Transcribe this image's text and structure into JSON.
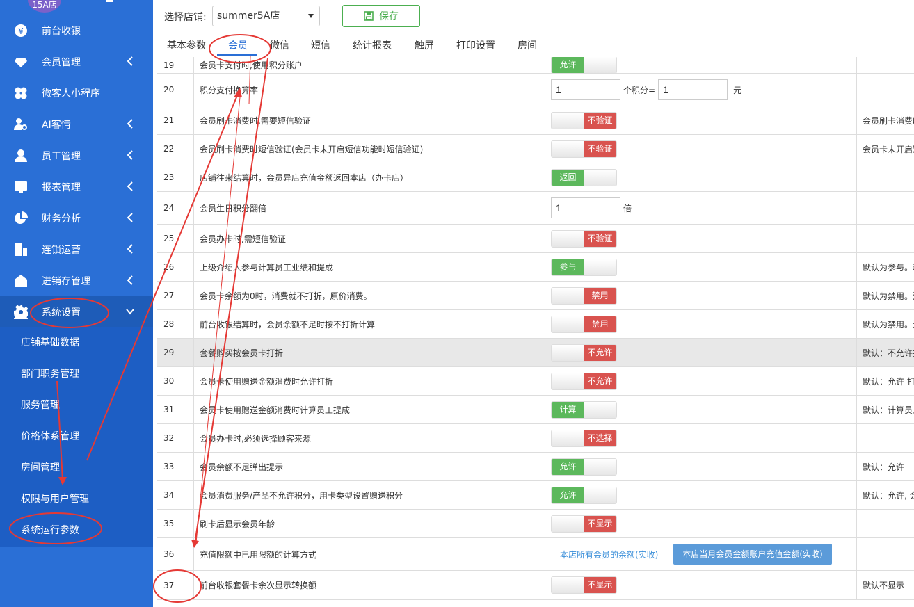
{
  "sidebar": {
    "avatar_text": "15A店",
    "items": [
      {
        "label": "前台收银",
        "icon": "yen-coin-icon",
        "has_chevron": false
      },
      {
        "label": "会员管理",
        "icon": "diamond-icon",
        "has_chevron": true
      },
      {
        "label": "微客人小程序",
        "icon": "clover-icon",
        "has_chevron": false
      },
      {
        "label": "AI客情",
        "icon": "user-search-icon",
        "has_chevron": true
      },
      {
        "label": "员工管理",
        "icon": "user-icon",
        "has_chevron": true
      },
      {
        "label": "报表管理",
        "icon": "monitor-icon",
        "has_chevron": true
      },
      {
        "label": "财务分析",
        "icon": "pie-chart-icon",
        "has_chevron": true
      },
      {
        "label": "连锁运营",
        "icon": "building-icon",
        "has_chevron": true
      },
      {
        "label": "进销存管理",
        "icon": "warehouse-icon",
        "has_chevron": true
      },
      {
        "label": "系统设置",
        "icon": "gear-icon",
        "has_chevron": true,
        "expanded": true
      }
    ],
    "sub_items": [
      "店铺基础数据",
      "部门职务管理",
      "服务管理",
      "价格体系管理",
      "房间管理",
      "权限与用户管理",
      "系统运行参数"
    ]
  },
  "topbar": {
    "shop_label": "选择店铺:",
    "shop_value": "summer5A店",
    "save_label": "保存",
    "tabs": [
      "基本参数",
      "会员",
      "微信",
      "短信",
      "统计报表",
      "触屏",
      "打印设置",
      "房间"
    ],
    "active_tab": "会员"
  },
  "rows": [
    {
      "num": "19",
      "name": "会员卡支付时,使用积分账户",
      "toggle": {
        "label": "允许",
        "state": "on"
      },
      "note": ""
    },
    {
      "num": "20",
      "name": "积分支付换算率",
      "inputs": {
        "a": "1",
        "a_unit": "个积分=",
        "b": "1",
        "b_unit": "元"
      },
      "note": ""
    },
    {
      "num": "21",
      "name": "会员刷卡消费时,需要短信验证",
      "toggle": {
        "label": "不验证",
        "state": "off"
      },
      "note": "会员刷卡消费时"
    },
    {
      "num": "22",
      "name": "会员刷卡消费时短信验证(会员卡未开启短信功能时短信验证)",
      "toggle": {
        "label": "不验证",
        "state": "off"
      },
      "note": "会员卡未开启短"
    },
    {
      "num": "23",
      "name": "店铺往来结算时，会员异店充值金额返回本店（办卡店）",
      "toggle": {
        "label": "返回",
        "state": "on"
      },
      "note": ""
    },
    {
      "num": "24",
      "name": "会员生日积分翻倍",
      "inputs": {
        "a": "1",
        "a_unit": "倍"
      },
      "note": ""
    },
    {
      "num": "25",
      "name": "会员办卡时,需短信验证",
      "toggle": {
        "label": "不验证",
        "state": "off"
      },
      "note": ""
    },
    {
      "num": "26",
      "name": "上级介绍人参与计算员工业绩和提成",
      "toggle": {
        "label": "参与",
        "state": "on"
      },
      "note": "默认为参与。着"
    },
    {
      "num": "27",
      "name": "会员卡余额为0时，消费就不打折，原价消费。",
      "toggle": {
        "label": "禁用",
        "state": "off"
      },
      "note": "默认为禁用。注"
    },
    {
      "num": "28",
      "name": "前台收银结算时，会员余额不足时按不打折计算",
      "toggle": {
        "label": "禁用",
        "state": "off"
      },
      "note": "默认为禁用。注"
    },
    {
      "num": "29",
      "name": "套餐购买按会员卡打折",
      "toggle": {
        "label": "不允许",
        "state": "off"
      },
      "note": "默认：不允许打",
      "highlight": true
    },
    {
      "num": "30",
      "name": "会员卡使用赠送金额消费时允许打折",
      "toggle": {
        "label": "不允许",
        "state": "off"
      },
      "note": "默认：允许 打"
    },
    {
      "num": "31",
      "name": "会员卡使用赠送金额消费时计算员工提成",
      "toggle": {
        "label": "计算",
        "state": "on"
      },
      "note": "默认：计算员工"
    },
    {
      "num": "32",
      "name": "会员办卡时,必须选择顾客来源",
      "toggle": {
        "label": "不选择",
        "state": "off"
      },
      "note": ""
    },
    {
      "num": "33",
      "name": "会员余额不足弹出提示",
      "toggle": {
        "label": "允许",
        "state": "on"
      },
      "note": "默认：允许"
    },
    {
      "num": "34",
      "name": "会员消费服务/产品不允许积分，用卡类型设置赠送积分",
      "toggle": {
        "label": "允许",
        "state": "on"
      },
      "note": "默认：允许, 会"
    },
    {
      "num": "35",
      "name": "刷卡后显示会员年龄",
      "toggle": {
        "label": "不显示",
        "state": "off"
      },
      "note": ""
    },
    {
      "num": "36",
      "name": "充值限额中已用限额的计算方式",
      "options": {
        "link": "本店所有会员的余额(实收)",
        "button": "本店当月会员金额账户充值金额(实收)"
      },
      "note": ""
    },
    {
      "num": "37",
      "name": "前台收银套餐卡余次显示转换额",
      "toggle": {
        "label": "不显示",
        "state": "off"
      },
      "note": "默认不显示"
    }
  ],
  "colors": {
    "sidebar": "#2a6fd6",
    "submenu": "#1d5ec4",
    "on": "#5cb85c",
    "off": "#d9534f",
    "annotation": "#e53935"
  }
}
